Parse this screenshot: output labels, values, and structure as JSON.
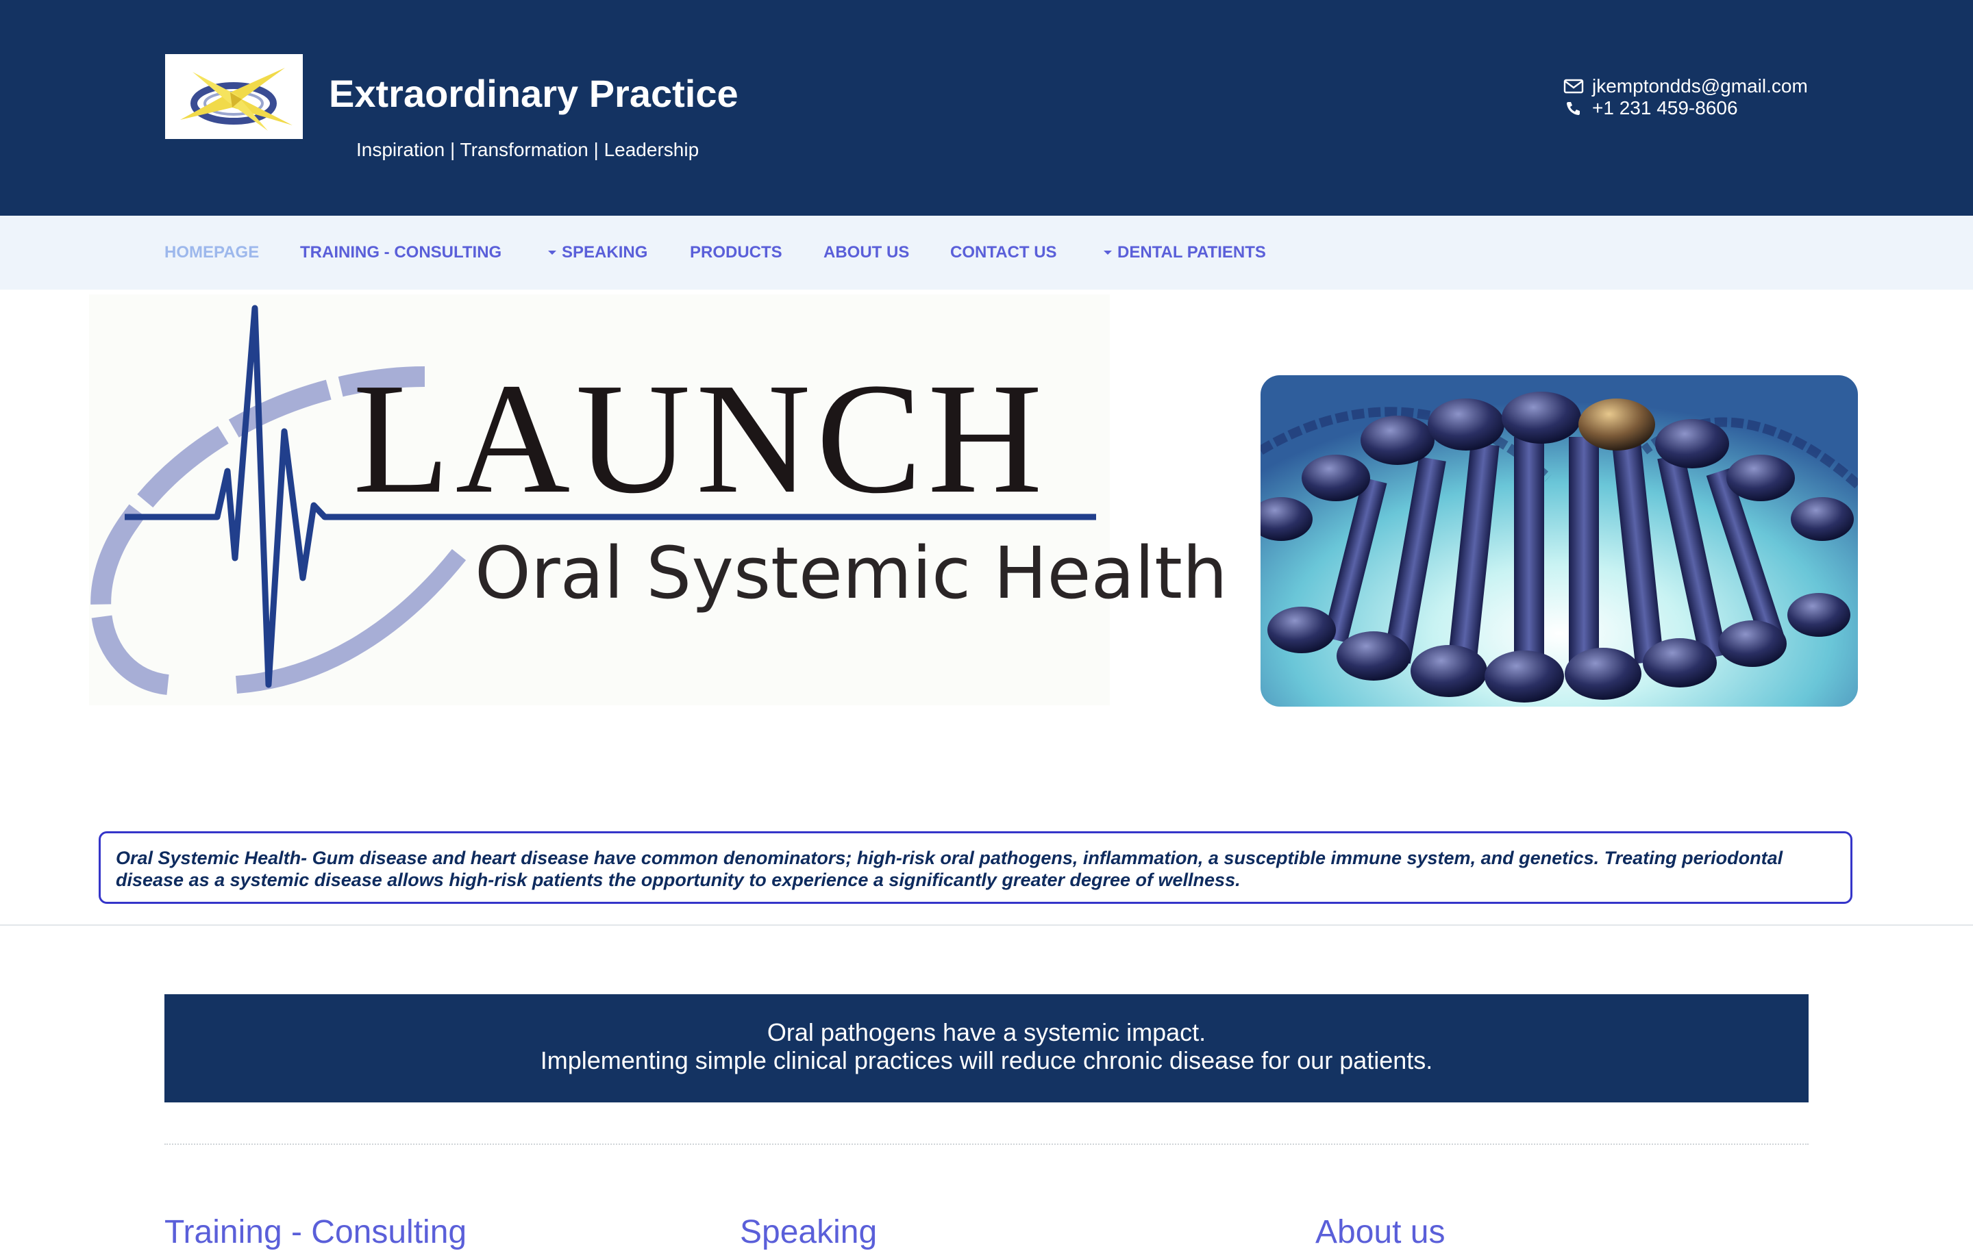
{
  "header": {
    "site_title": "Extraordinary Practice",
    "tagline": "Inspiration | Transformation | Leadership",
    "email": "jkemptondds@gmail.com",
    "phone": "+1 231 459-8606",
    "logo_icon": "lightning-x-logo",
    "background_color": "#143362"
  },
  "nav": {
    "items": [
      {
        "label": "HOMEPAGE",
        "active": true
      },
      {
        "label": "TRAINING - CONSULTING"
      },
      {
        "label": "SPEAKING",
        "has_dropdown": true
      },
      {
        "label": "PRODUCTS"
      },
      {
        "label": "ABOUT US"
      },
      {
        "label": "CONTACT US"
      },
      {
        "label": "DENTAL PATIENTS",
        "has_dropdown": true
      }
    ],
    "color": "#5a5fd9",
    "active_color": "#9db8ec"
  },
  "hero": {
    "launch_title": "LAUNCH",
    "launch_subtitle": "Oral Systemic Health",
    "dna_image": "dna-helix-image"
  },
  "intro": {
    "text": "Oral Systemic Health- Gum disease and heart disease have common denominators; high-risk oral pathogens, inflammation, a susceptible immune system, and genetics. Treating periodontal disease as a systemic disease allows high-risk patients the opportunity to experience a significantly greater degree of wellness."
  },
  "banner": {
    "line1": "Oral pathogens have a systemic impact.",
    "line2": "Implementing simple clinical practices will reduce chronic disease for our patients."
  },
  "sections": [
    {
      "heading": "Training - Consulting"
    },
    {
      "heading": "Speaking"
    },
    {
      "heading": "About us"
    }
  ]
}
